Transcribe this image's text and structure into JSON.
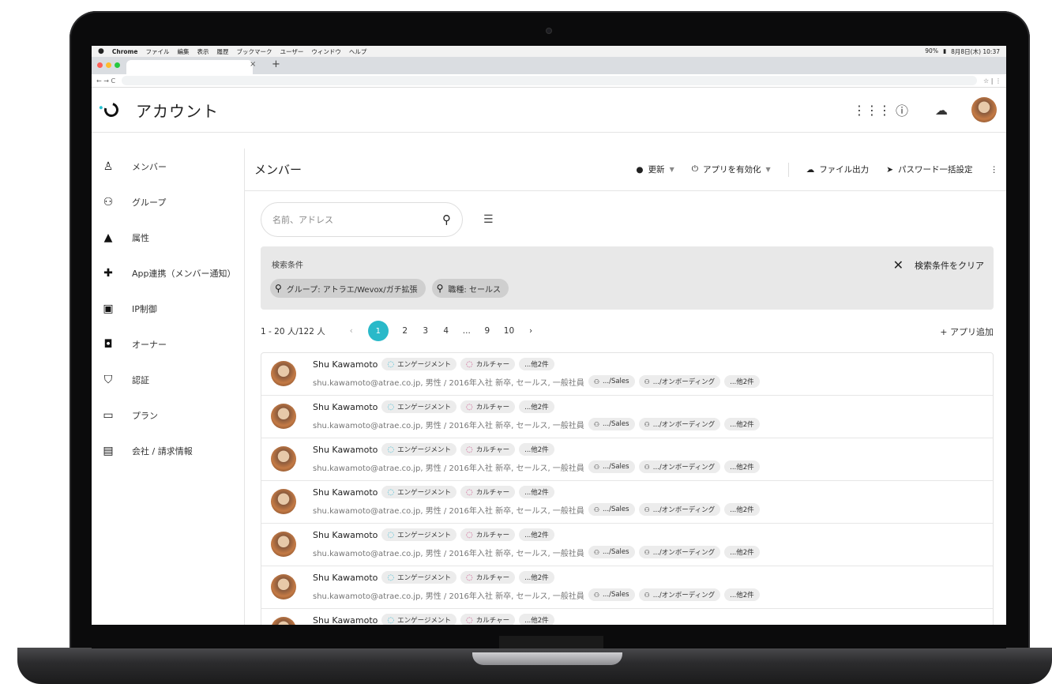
{
  "menubar": {
    "apple": "",
    "items": [
      "Chrome",
      "ファイル",
      "編集",
      "表示",
      "履歴",
      "ブックマーク",
      "ユーザー",
      "ウィンドウ",
      "ヘルプ"
    ],
    "battery": "90%",
    "date": "8月8日(木) 10:37"
  },
  "browser": {
    "tab_close": "×",
    "new_tab": "+",
    "nav": "← → C",
    "star": "☆ | ⋮"
  },
  "app": {
    "title": "アカウント"
  },
  "sidebar": {
    "items": [
      {
        "label": "メンバー",
        "icon": "person-icon"
      },
      {
        "label": "グループ",
        "icon": "group-icon"
      },
      {
        "label": "属性",
        "icon": "shapes-icon"
      },
      {
        "label": "App連携（メンバー通知）",
        "icon": "puzzle-icon"
      },
      {
        "label": "IP制御",
        "icon": "lock-icon"
      },
      {
        "label": "オーナー",
        "icon": "owner-icon"
      },
      {
        "label": "認証",
        "icon": "shield-icon"
      },
      {
        "label": "プラン",
        "icon": "card-icon"
      },
      {
        "label": "会社 / 請求情報",
        "icon": "document-icon"
      }
    ]
  },
  "toolbar": {
    "title": "メンバー",
    "update": "更新",
    "enable_app": "アプリを有効化",
    "export": "ファイル出力",
    "password": "パスワード一括設定"
  },
  "search": {
    "placeholder": "名前、アドレス"
  },
  "conditions": {
    "label": "検索条件",
    "clear": "検索条件をクリア",
    "chips": [
      "グループ: アトラエ/Wevox/ガチ拡張",
      "職種: セールス"
    ]
  },
  "pager": {
    "range": "1 - 20 人/122 人",
    "prev": "‹",
    "pages": [
      "1",
      "2",
      "3",
      "4",
      "...",
      "9",
      "10"
    ],
    "next": "›",
    "add_app": "+ アプリ追加"
  },
  "member": {
    "name": "Shu Kawamoto",
    "tag_engagement": "エンゲージメント",
    "tag_culture": "カルチャー",
    "tag_more": "...他2件",
    "detail": "shu.kawamoto@atrae.co.jp, 男性 / 2016年入社 新卒, セールス, 一般社員",
    "group_sales": ".../Sales",
    "group_onboarding": ".../オンボーディング",
    "group_more": "...他2件"
  },
  "colors": {
    "accent": "#29b9c9",
    "engagement": "#2bb6d0",
    "culture": "#c6387a"
  }
}
